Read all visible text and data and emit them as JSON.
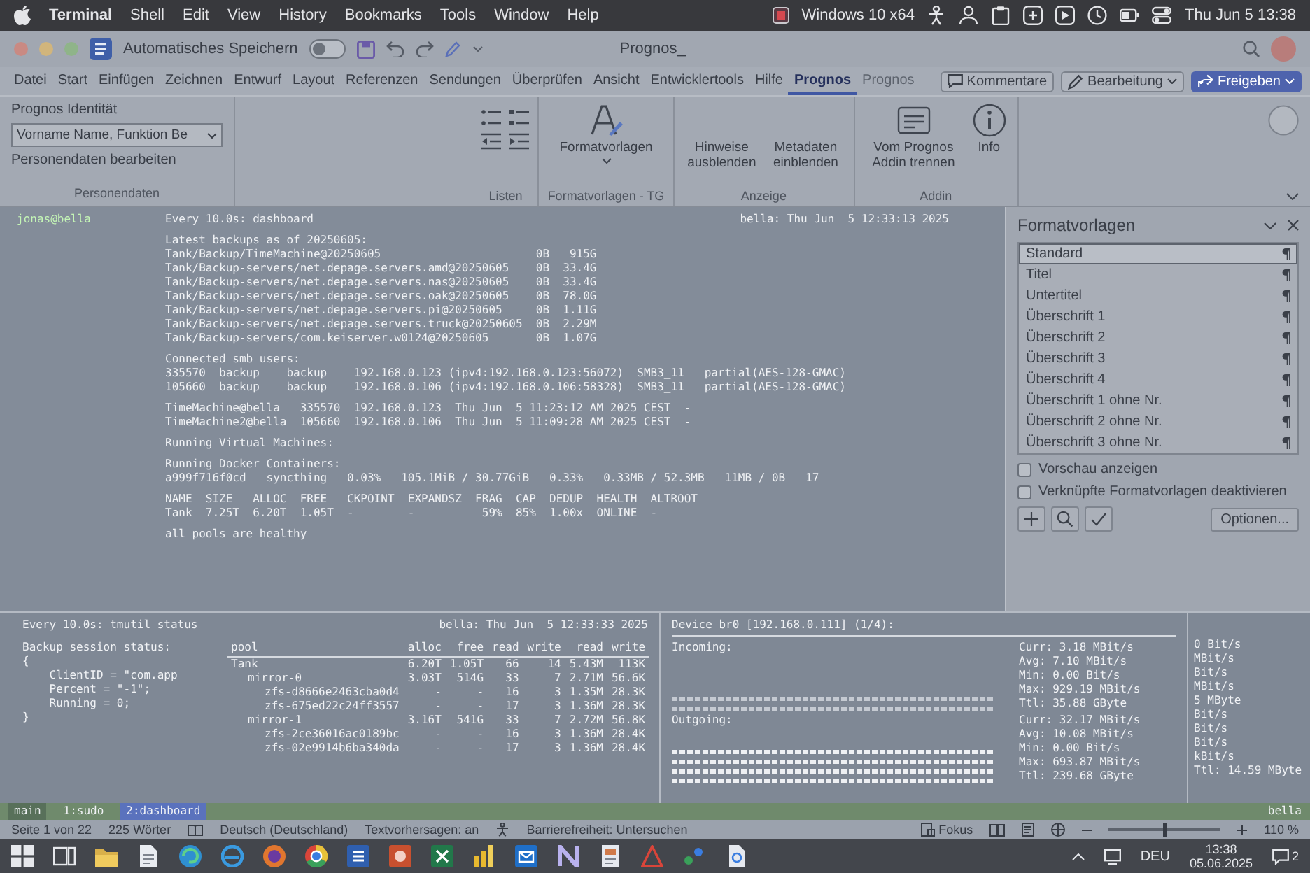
{
  "menu_bar": {
    "menus": [
      "Terminal",
      "Shell",
      "Edit",
      "View",
      "History",
      "Bookmarks",
      "Tools",
      "Window",
      "Help"
    ],
    "vm": "Windows 10 x64",
    "clock": "Thu Jun 5 13:38"
  },
  "word": {
    "autosave": {
      "label": "Automatisches Speichern",
      "on": false
    },
    "title": "Prognos_",
    "tabs": [
      {
        "label": "Datei",
        "selected": false,
        "disabled": false
      },
      {
        "label": "Start",
        "selected": false,
        "disabled": false
      },
      {
        "label": "Einfügen",
        "selected": false,
        "disabled": false
      },
      {
        "label": "Zeichnen",
        "selected": false,
        "disabled": false
      },
      {
        "label": "Entwurf",
        "selected": false,
        "disabled": false
      },
      {
        "label": "Layout",
        "selected": false,
        "disabled": false
      },
      {
        "label": "Referenzen",
        "selected": false,
        "disabled": false
      },
      {
        "label": "Sendungen",
        "selected": false,
        "disabled": false
      },
      {
        "label": "Überprüfen",
        "selected": false,
        "disabled": false
      },
      {
        "label": "Ansicht",
        "selected": false,
        "disabled": false
      },
      {
        "label": "Entwicklertools",
        "selected": false,
        "disabled": false
      },
      {
        "label": "Hilfe",
        "selected": false,
        "disabled": false
      },
      {
        "label": "Prognos",
        "selected": true,
        "disabled": false
      },
      {
        "label": "Prognos",
        "selected": false,
        "disabled": true
      }
    ],
    "actions": [
      {
        "kind": "comments",
        "label": "Kommentare"
      },
      {
        "kind": "editing",
        "label": "Bearbeitung"
      },
      {
        "kind": "share",
        "label": "Freigeben"
      }
    ],
    "ribbon": {
      "identity": {
        "label": "Prognos Identität",
        "person": "Vorname Name, Funktion Be",
        "edit": "Personendaten bearbeiten",
        "group": "Personendaten"
      },
      "groups": [
        {
          "label": "Listen",
          "buttons": [
            {
              "kind": "bullets"
            },
            {
              "kind": "numbering"
            },
            {
              "kind": "outdent"
            },
            {
              "kind": "indent"
            }
          ]
        },
        {
          "label": "Formatvorlagen - TG",
          "buttons": [
            {
              "kind": "styles",
              "label": "Formatvorlagen"
            }
          ]
        },
        {
          "label": "Anzeige",
          "buttons": [
            {
              "kind": "text",
              "label": "Hinweise ausblenden"
            },
            {
              "kind": "text",
              "label": "Metadaten einblenden"
            }
          ]
        },
        {
          "label": "Addin",
          "buttons": [
            {
              "kind": "disconnect",
              "label": "Vom Prognos Addin trennen"
            },
            {
              "kind": "info",
              "label": "Info"
            }
          ]
        }
      ]
    }
  },
  "dashboard": {
    "prompt": "jonas@bella",
    "command": "Every 10.0s: dashboard",
    "host_time": "bella: Thu Jun  5 12:33:13 2025",
    "sections": [
      [
        "Latest backups as of 20250605:",
        "Tank/Backup/TimeMachine@20250605                       0B   915G",
        "Tank/Backup-servers/net.depage.servers.amd@20250605    0B  33.4G",
        "Tank/Backup-servers/net.depage.servers.nas@20250605    0B  33.4G",
        "Tank/Backup-servers/net.depage.servers.oak@20250605    0B  78.0G",
        "Tank/Backup-servers/net.depage.servers.pi@20250605     0B  1.11G",
        "Tank/Backup-servers/net.depage.servers.truck@20250605  0B  2.29M",
        "Tank/Backup-servers/com.keiserver.w0124@20250605       0B  1.07G"
      ],
      [
        "Connected smb users:",
        "335570  backup    backup    192.168.0.123 (ipv4:192.168.0.123:56072)  SMB3_11   partial(AES-128-GMAC)",
        "105660  backup    backup    192.168.0.106 (ipv4:192.168.0.106:58328)  SMB3_11   partial(AES-128-GMAC)"
      ],
      [
        "TimeMachine@bella   335570  192.168.0.123  Thu Jun  5 11:23:12 AM 2025 CEST  -",
        "TimeMachine2@bella  105660  192.168.0.106  Thu Jun  5 11:09:28 AM 2025 CEST  -"
      ],
      [
        "Running Virtual Machines:"
      ],
      [
        "Running Docker Containers:",
        "a999f716f0cd   syncthing   0.03%   105.1MiB / 30.77GiB   0.33%   0.33MB / 52.3MB   11MB / 0B   17"
      ],
      [
        "NAME  SIZE   ALLOC  FREE   CKPOINT  EXPANDSZ  FRAG  CAP  DEDUP  HEALTH  ALTROOT",
        "Tank  7.25T  6.20T  1.05T  -        -          59%  85%  1.00x  ONLINE  -"
      ],
      [
        "all pools are healthy"
      ]
    ]
  },
  "styles_pane": {
    "title": "Formatvorlagen",
    "styles": [
      {
        "name": "Standard",
        "selected": true
      },
      {
        "name": "Titel",
        "selected": false
      },
      {
        "name": "Untertitel",
        "selected": false
      },
      {
        "name": "Überschrift 1",
        "selected": false
      },
      {
        "name": "Überschrift 2",
        "selected": false
      },
      {
        "name": "Überschrift 3",
        "selected": false
      },
      {
        "name": "Überschrift 4",
        "selected": false
      },
      {
        "name": "Überschrift 1 ohne Nr.",
        "selected": false
      },
      {
        "name": "Überschrift 2 ohne Nr.",
        "selected": false
      },
      {
        "name": "Überschrift 3 ohne Nr.",
        "selected": false
      }
    ],
    "options": [
      {
        "label": "Vorschau anzeigen",
        "checked": false
      },
      {
        "label": "Verknüpfte Formatvorlagen deaktivieren",
        "checked": false
      }
    ],
    "options_button": "Optionen..."
  },
  "tmutil": {
    "command": "Every 10.0s: tmutil status",
    "host_time": "bella: Thu Jun  5 12:33:33 2025",
    "lines": [
      "Backup session status:",
      "{",
      "    ClientID = \"com.app",
      "    Percent = \"-1\";",
      "    Running = 0;",
      "}"
    ]
  },
  "zpool_iostat": {
    "columns": [
      "pool",
      "alloc",
      "free",
      "read",
      "write",
      "read",
      "write"
    ],
    "rows": [
      {
        "cells": [
          "Tank",
          "6.20T",
          "1.05T",
          "66",
          "14",
          "5.43M",
          "113K"
        ],
        "children": [
          {
            "cells": [
              "mirror-0",
              "3.03T",
              "514G",
              "33",
              "7",
              "2.71M",
              "56.6K"
            ],
            "children": [
              {
                "cells": [
                  "zfs-d8666e2463cba0d4",
                  "-",
                  "-",
                  "16",
                  "3",
                  "1.35M",
                  "28.3K"
                ]
              },
              {
                "cells": [
                  "zfs-675ed22c24ff3557",
                  "-",
                  "-",
                  "17",
                  "3",
                  "1.36M",
                  "28.3K"
                ]
              }
            ]
          },
          {
            "cells": [
              "mirror-1",
              "3.16T",
              "541G",
              "33",
              "7",
              "2.72M",
              "56.8K"
            ],
            "children": [
              {
                "cells": [
                  "zfs-2ce36016ac0189bc",
                  "-",
                  "-",
                  "16",
                  "3",
                  "1.36M",
                  "28.4K"
                ]
              },
              {
                "cells": [
                  "zfs-02e9914b6ba340da",
                  "-",
                  "-",
                  "17",
                  "3",
                  "1.36M",
                  "28.4K"
                ]
              }
            ]
          }
        ]
      }
    ]
  },
  "nload": {
    "device": "Device br0 [192.168.0.111] (1/4):",
    "directions": [
      {
        "label": "Incoming:",
        "stats": [
          "Curr: 3.18 MBit/s",
          "Avg: 7.10 MBit/s",
          "Min: 0.00 Bit/s",
          "Max: 929.19 MBit/s",
          "Ttl: 35.88 GByte"
        ]
      },
      {
        "label": "Outgoing:",
        "stats": [
          "Curr: 32.17 MBit/s",
          "Avg: 10.08 MBit/s",
          "Min: 0.00 Bit/s",
          "Max: 693.87 MBit/s",
          "Ttl: 239.68 GByte"
        ]
      }
    ]
  },
  "nload_partial": {
    "lines": [
      "0 Bit/s",
      "MBit/s",
      "Bit/s",
      "MBit/s",
      "5 MByte",
      "Bit/s",
      "Bit/s",
      "Bit/s",
      "kBit/s",
      "Ttl: 14.59 MByte"
    ]
  },
  "tmux": {
    "session": "main",
    "windows": [
      {
        "label": "1:sudo",
        "selected": false
      },
      {
        "label": "2:dashboard",
        "selected": true
      }
    ],
    "host": "bella"
  },
  "status_bar": {
    "page": "Seite 1 von 22",
    "words": "225 Wörter",
    "language": "Deutsch (Deutschland)",
    "predictions": "Textvorhersagen: an",
    "accessibility": "Barrierefreiheit: Untersuchen",
    "focus": "Fokus",
    "zoom": {
      "level": 0.5,
      "label": "110 %"
    }
  },
  "taskbar": {
    "language": "DEU",
    "time": "13:38",
    "date": "05.06.2025",
    "notifications": "2"
  }
}
